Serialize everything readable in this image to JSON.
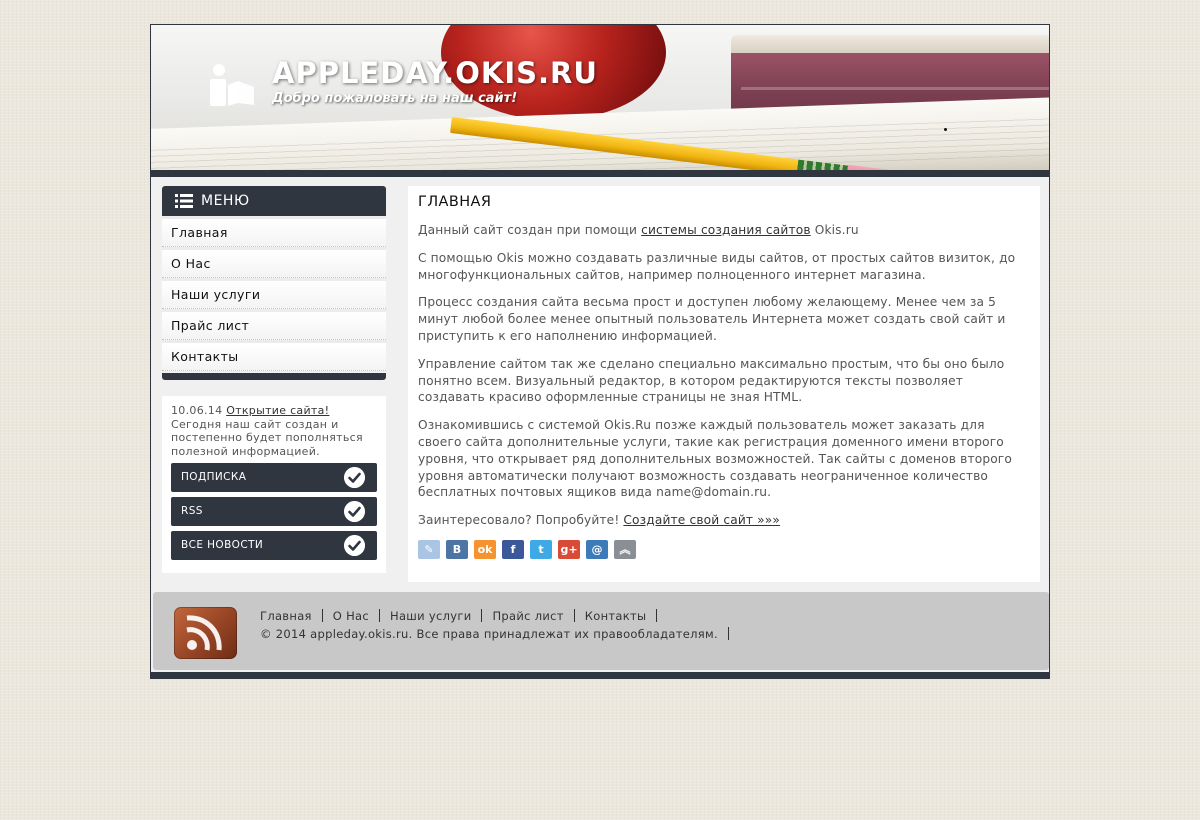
{
  "header": {
    "site_title": "APPLEDAY.OKIS.RU",
    "site_subtitle": "Добро пожаловать на наш сайт!"
  },
  "sidebar": {
    "menu_title": "МЕНЮ",
    "items": [
      {
        "label": "Главная"
      },
      {
        "label": "О Нас"
      },
      {
        "label": "Наши услуги"
      },
      {
        "label": "Прайс лист"
      },
      {
        "label": "Контакты"
      }
    ],
    "news": {
      "date": "10.06.14",
      "link_text": "Открытие сайта!",
      "text": "Сегодня наш сайт создан и постепенно будет пополняться полезной информацией."
    },
    "buttons": [
      {
        "label": "ПОДПИСКА"
      },
      {
        "label": "RSS"
      },
      {
        "label": "ВСЕ НОВОСТИ"
      }
    ]
  },
  "main": {
    "title": "ГЛАВНАЯ",
    "p1_prefix": "Данный сайт создан при помощи ",
    "p1_link": "системы создания сайтов",
    "p1_suffix": " Okis.ru",
    "p2": "С помощью Okis можно создавать различные виды сайтов, от простых сайтов визиток, до многофункциональных сайтов, например полноценного интернет магазина.",
    "p3": "Процесс создания сайта весьма прост и доступен любому желающему. Менее чем за 5 минут любой более менее опытный пользователь Интернета может создать свой сайт и приступить к его наполнению информацией.",
    "p4": "Управление сайтом так же сделано специально максимально простым, что бы оно было понятно всем. Визуальный редактор, в котором редактируются тексты позволяет создавать красиво оформленные страницы не зная HTML.",
    "p5": "Ознакомившись с системой Okis.Ru позже каждый пользователь может заказать для своего сайта дополнительные услуги, такие как регистрация доменного имени второго уровня, что открывает ряд дополнительных возможностей. Так сайты с доменов второго уровня автоматически получают возможность создавать неограниченное количество бесплатных почтовых ящиков вида name@domain.ru.",
    "p6_prefix": "Заинтересовало? Попробуйте! ",
    "p6_link": "Создайте свой сайт »»»",
    "share": [
      {
        "icon": "livejournal-icon",
        "glyph": "✎",
        "color": "#a9c5e3"
      },
      {
        "icon": "vkontakte-icon",
        "glyph": "В",
        "color": "#4c75a3"
      },
      {
        "icon": "odnoklassniki-icon",
        "glyph": "ok",
        "color": "#f59331"
      },
      {
        "icon": "facebook-icon",
        "glyph": "f",
        "color": "#3b5998"
      },
      {
        "icon": "twitter-icon",
        "glyph": "t",
        "color": "#3ea9e4"
      },
      {
        "icon": "google-plus-icon",
        "glyph": "g+",
        "color": "#d84b37"
      },
      {
        "icon": "mail-ru-icon",
        "glyph": "@",
        "color": "#3c7bb8"
      },
      {
        "icon": "more-share-icon",
        "glyph": "︽",
        "color": "#8a8f96"
      }
    ]
  },
  "footer": {
    "nav": [
      {
        "label": "Главная"
      },
      {
        "label": "О Нас"
      },
      {
        "label": "Наши услуги"
      },
      {
        "label": "Прайс лист"
      },
      {
        "label": "Контакты"
      }
    ],
    "copyright": "© 2014 appleday.okis.ru. Все права принадлежат их правообладателям."
  },
  "colors": {
    "dark_bar": "#2f3640",
    "page_background": "#ece7dd",
    "footer_background": "#c8c8c8"
  }
}
